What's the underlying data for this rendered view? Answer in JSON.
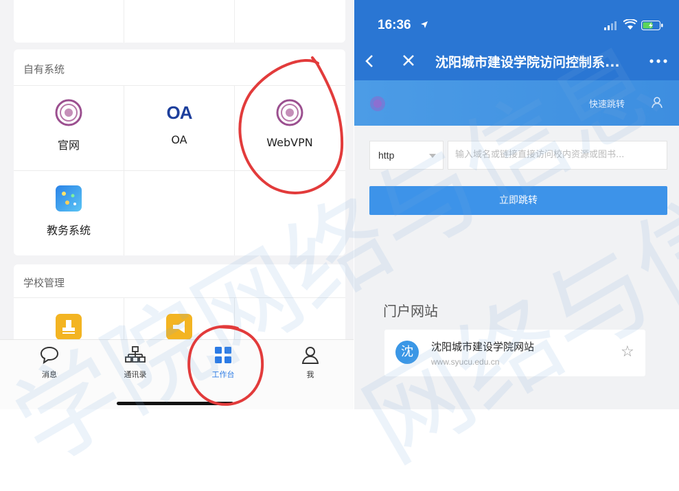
{
  "left_phone": {
    "sections": {
      "own_systems": "自有系统",
      "school_admin": "学校管理"
    },
    "apps": [
      {
        "label": "官网",
        "icon": "school-emblem-icon"
      },
      {
        "label": "OA",
        "icon": "oa-logo-icon",
        "logo_text": "OA"
      },
      {
        "label": "WebVPN",
        "icon": "school-emblem-icon"
      },
      {
        "label": "教务系统",
        "icon": "academic-system-icon"
      }
    ],
    "tabbar": [
      {
        "label": "消息",
        "icon": "chat-bubble-icon",
        "active": false
      },
      {
        "label": "通讯录",
        "icon": "org-chart-icon",
        "active": false
      },
      {
        "label": "工作台",
        "icon": "grid-icon",
        "active": true
      },
      {
        "label": "我",
        "icon": "person-icon",
        "active": false
      }
    ]
  },
  "right_phone": {
    "status_bar": {
      "time": "16:36"
    },
    "nav": {
      "title": "沈阳城市建设学院访问控制系..."
    },
    "banner": {
      "quick_jump": "快速跳转"
    },
    "form": {
      "protocol": "http",
      "url_placeholder": "输入域名或链接直接访问校内资源或图书..."
    },
    "go_button": "立即跳转",
    "portal": {
      "title": "门户网站",
      "site_name": "沈阳城市建设学院网站",
      "site_url": "www.syucu.edu.cn",
      "badge": "沈"
    }
  },
  "watermark": [
    "学院网络与信息",
    "网络与信"
  ],
  "colors": {
    "brand_blue": "#2a76d3",
    "button_blue": "#3d93e9",
    "active_tab": "#2c7be5",
    "annotation_red": "#e23b3b"
  }
}
